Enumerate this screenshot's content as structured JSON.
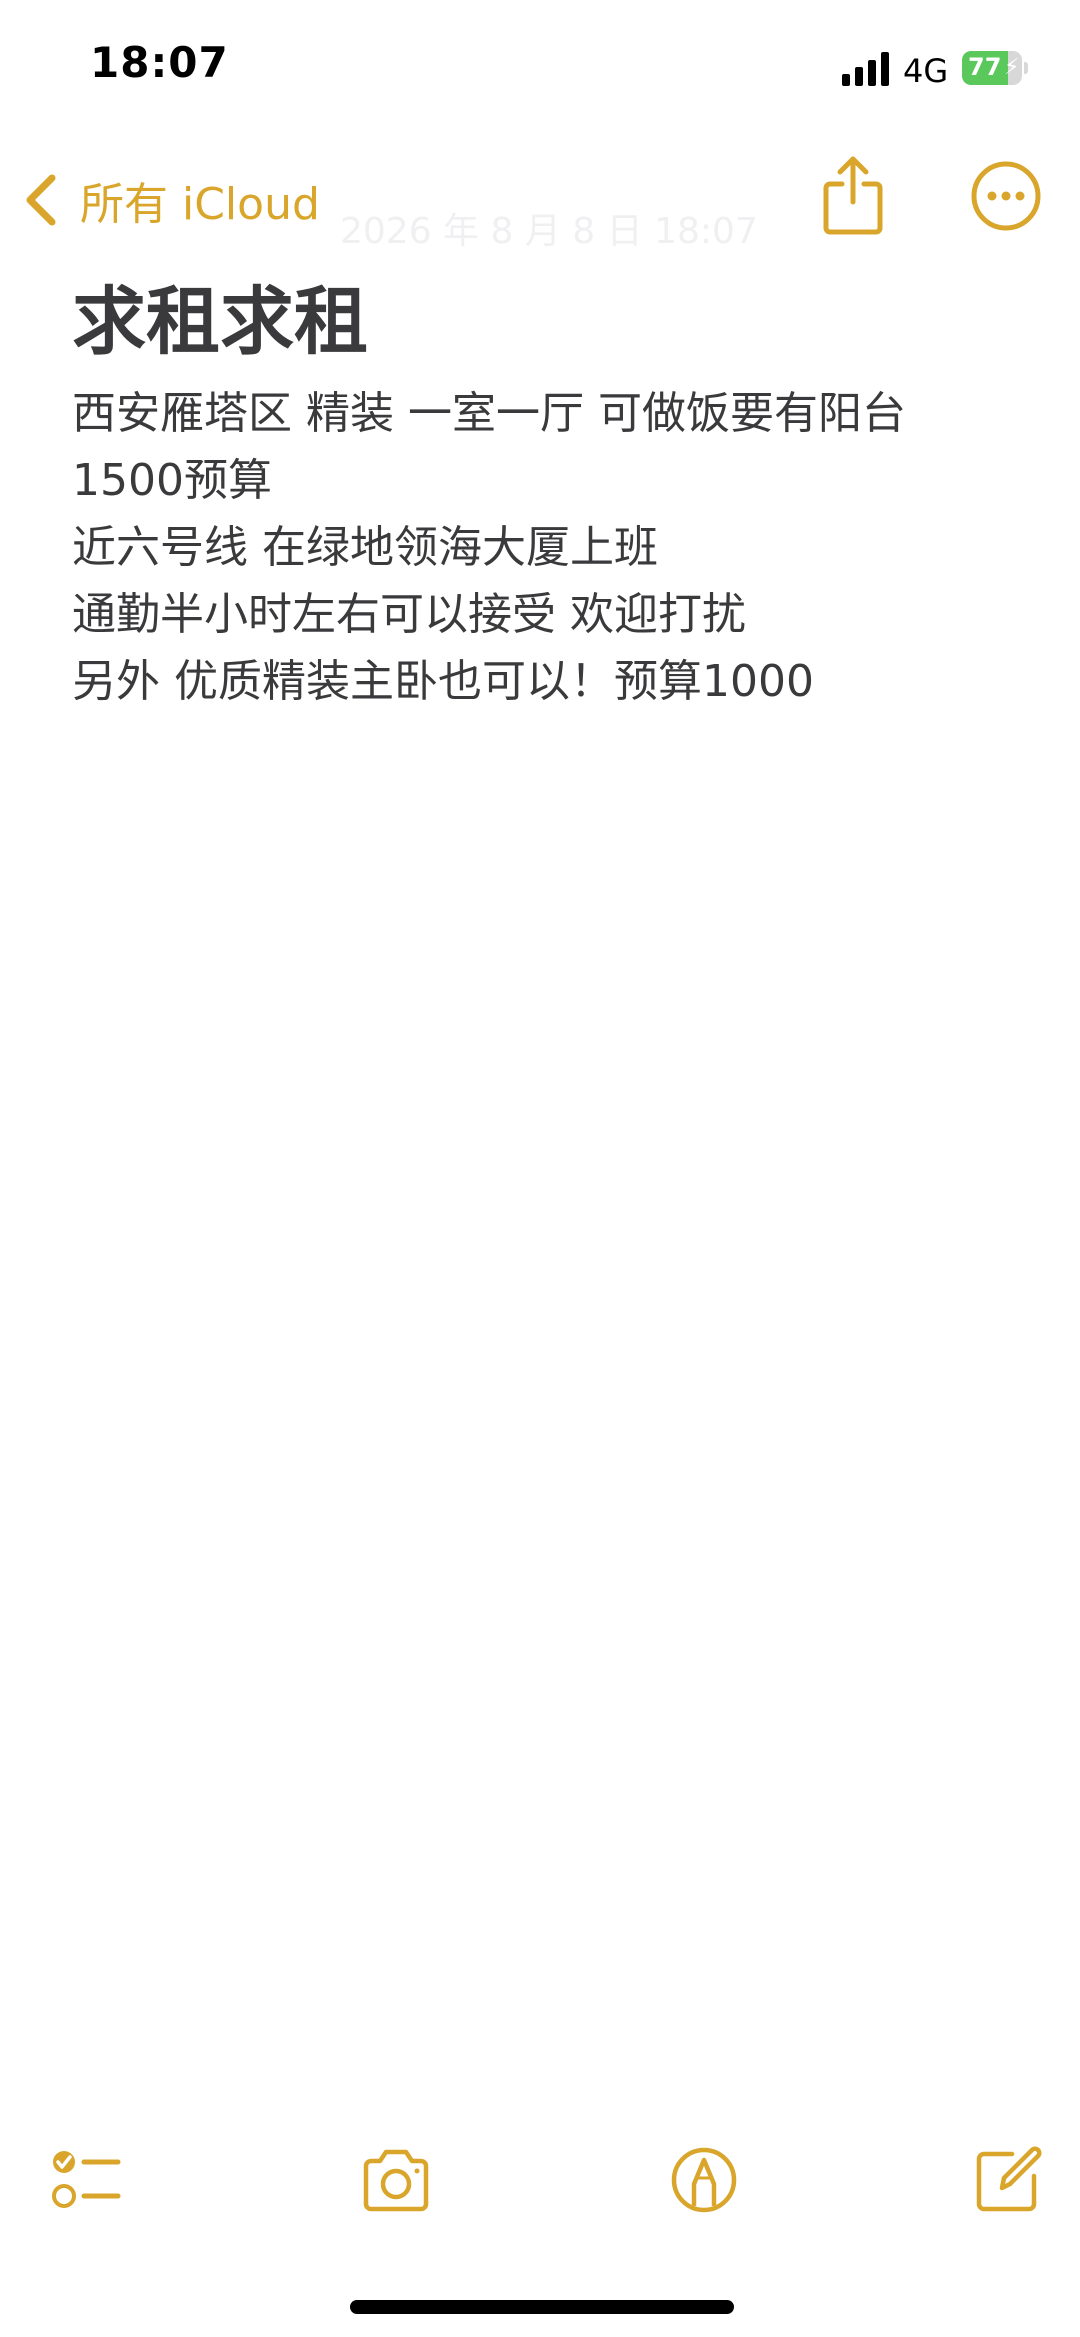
{
  "status_bar": {
    "time": "18:07",
    "network": "4G",
    "battery_level": "77",
    "battery_fraction": 0.77,
    "signal_icon": "cellular-signal-icon"
  },
  "nav": {
    "back_label": "所有 iCloud",
    "faded_date": "2026 年 8 月 8 日 18:07",
    "share_icon": "share-icon",
    "more_icon": "ellipsis-circle-icon"
  },
  "note": {
    "title": "求租求租",
    "lines": [
      "西安雁塔区 精装 一室一厅 可做饭要有阳台",
      "1500预算",
      "近六号线 在绿地领海大厦上班",
      "通勤半小时左右可以接受 欢迎打扰",
      "另外 优质精装主卧也可以！预算1000"
    ]
  },
  "toolbar": {
    "checklist_icon": "checklist-icon",
    "camera_icon": "camera-icon",
    "markup_icon": "markup-pen-icon",
    "compose_icon": "compose-icon"
  },
  "colors": {
    "accent": "#d9a52b",
    "text": "#3a3a3c",
    "battery_green": "#5ac85a"
  }
}
